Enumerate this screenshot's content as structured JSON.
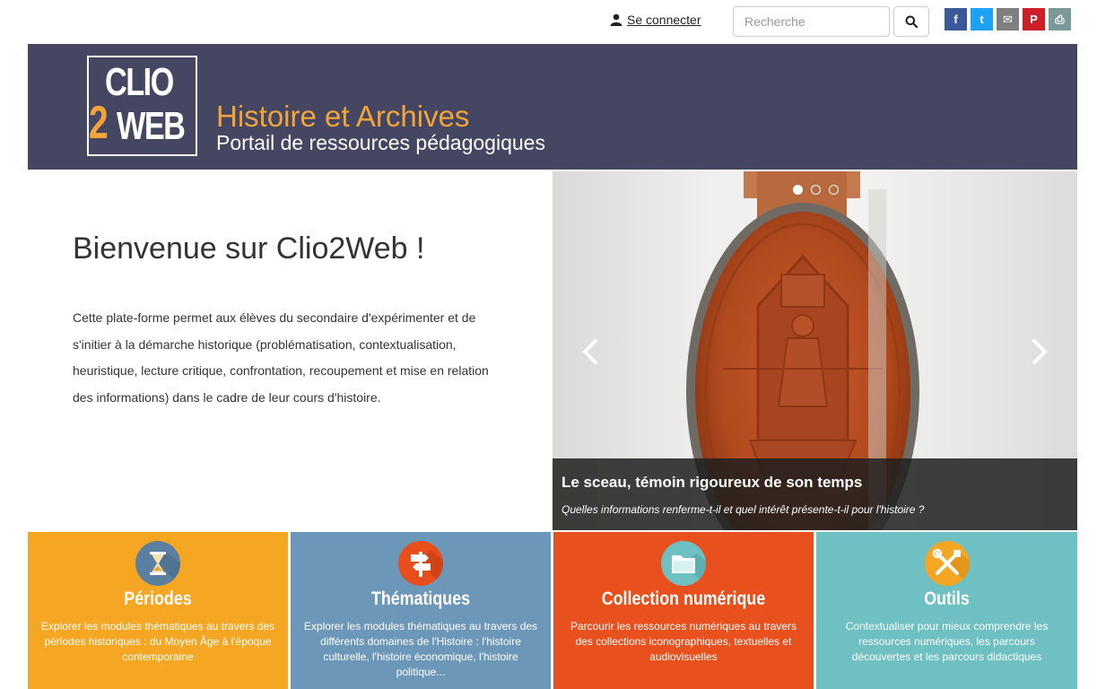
{
  "topbar": {
    "login_label": "Se connecter",
    "search_placeholder": "Recherche",
    "social": [
      {
        "name": "facebook",
        "glyph": "f",
        "color": "#3b5998"
      },
      {
        "name": "twitter",
        "glyph": "t",
        "color": "#1da1f2"
      },
      {
        "name": "email",
        "glyph": "✉",
        "color": "#7f7f7f"
      },
      {
        "name": "pinterest",
        "glyph": "P",
        "color": "#cb2027"
      },
      {
        "name": "print",
        "glyph": "⎙",
        "color": "#7a9a9a"
      }
    ]
  },
  "banner": {
    "logo_line1": "CLIO",
    "logo_digit": "2",
    "logo_line2": "WEB",
    "title": "Histoire et Archives",
    "subtitle": "Portail de ressources pédagogiques"
  },
  "intro": {
    "title": "Bienvenue sur Clio2Web !",
    "text": "Cette plate-forme permet aux élèves du secondaire d'expérimenter et de s'initier à la démarche historique (problématisation, contextualisation, heuristique, lecture critique, confrontation, recoupement et mise en relation des informations) dans le cadre de leur cours d'histoire."
  },
  "carousel": {
    "slide_count": 3,
    "active_index": 0,
    "caption_title": "Le sceau, témoin rigoureux de son temps",
    "caption_subtitle": "Quelles informations renferme-t-il et quel intérêt présente-t-il pour l'histoire ?"
  },
  "tiles": [
    {
      "title": "Périodes",
      "desc": "Explorer les modules thématiques au travers des périodes historiques : du Moyen Âge à l'époque contemporaine",
      "color": "#f5a623",
      "icon": "hourglass-icon"
    },
    {
      "title": "Thématiques",
      "desc": "Explorer les modules thématiques au travers des différents domaines de l'Histoire : l'histoire culturelle, l'histoire économique, l'histoire politique...",
      "color": "#6d97b8",
      "icon": "signpost-icon"
    },
    {
      "title": "Collection numérique",
      "desc": "Parcourir les ressources numériques au travers des collections iconographiques, textuelles et audiovisuelles",
      "color": "#e8501d",
      "icon": "folder-icon"
    },
    {
      "title": "Outils",
      "desc": "Contextualiser pour mieux comprendre les ressources numériques, les parcours découvertes et les parcours didactiques",
      "color": "#6fc0c2",
      "icon": "tools-icon"
    }
  ]
}
